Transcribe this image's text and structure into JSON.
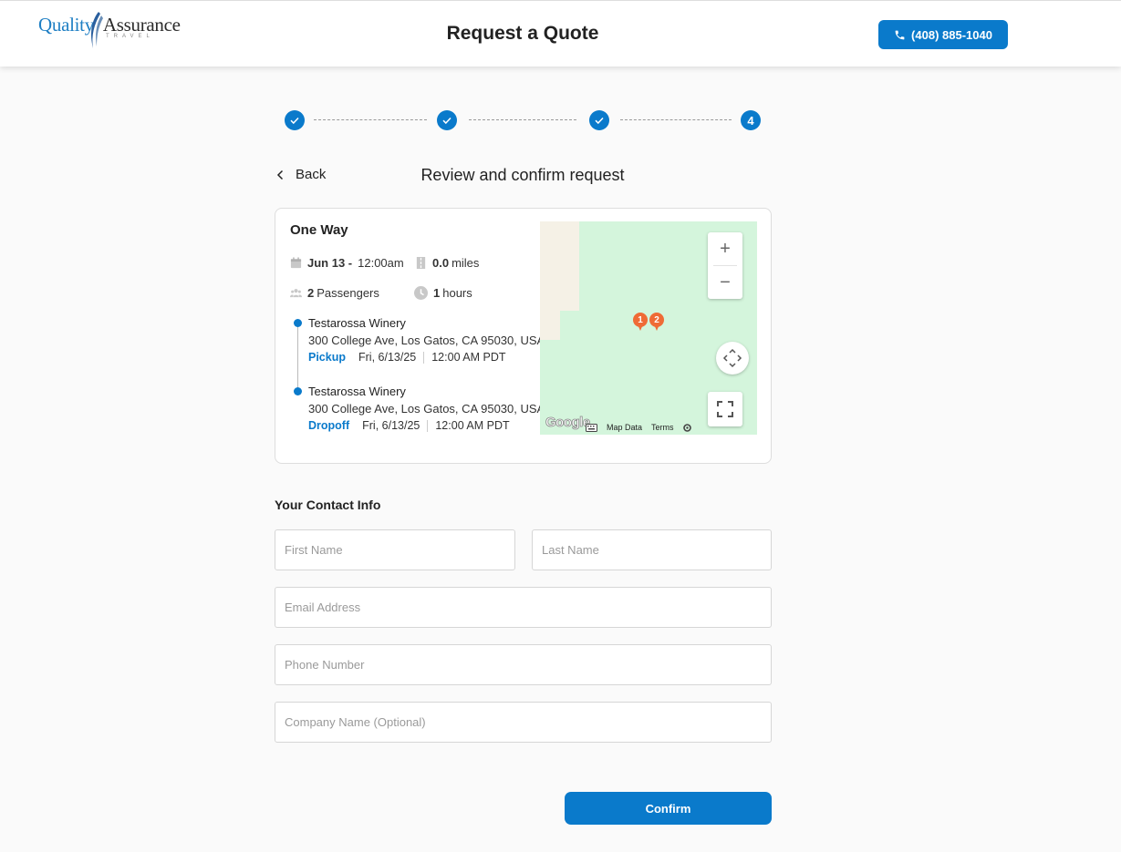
{
  "header": {
    "logo": {
      "word1": "Quality",
      "word2": "Assurance",
      "tagline": "TRAVEL"
    },
    "title": "Request a Quote",
    "phone_label": "(408) 885-1040"
  },
  "stepper": {
    "steps": [
      {
        "state": "complete"
      },
      {
        "state": "complete"
      },
      {
        "state": "complete"
      },
      {
        "state": "current",
        "label": "4"
      }
    ]
  },
  "nav": {
    "back_label": "Back",
    "subtitle": "Review and confirm request"
  },
  "trip": {
    "type": "One Way",
    "date": "Jun 13 -",
    "time": "12:00am",
    "distance_value": "0.0",
    "distance_unit": "miles",
    "passengers_value": "2",
    "passengers_unit": "Passengers",
    "duration_value": "1",
    "duration_unit": "hours",
    "stops": [
      {
        "name": "Testarossa Winery",
        "address": "300 College Ave, Los Gatos, CA 95030, USA",
        "kind": "Pickup",
        "date": "Fri, 6/13/25",
        "time": "12:00 AM PDT"
      },
      {
        "name": "Testarossa Winery",
        "address": "300 College Ave, Los Gatos, CA 95030, USA",
        "kind": "Dropoff",
        "date": "Fri, 6/13/25",
        "time": "12:00 AM PDT"
      }
    ]
  },
  "map": {
    "zoom_in": "+",
    "zoom_out": "−",
    "pins": [
      "1",
      "2"
    ],
    "google_label": "Google",
    "map_data_label": "Map Data",
    "terms_label": "Terms"
  },
  "contact": {
    "title": "Your Contact Info",
    "first_name_placeholder": "First Name",
    "last_name_placeholder": "Last Name",
    "email_placeholder": "Email Address",
    "phone_placeholder": "Phone Number",
    "company_placeholder": "Company Name (Optional)"
  },
  "confirm_label": "Confirm",
  "colors": {
    "accent": "#0a7acb",
    "pin": "#ef6b36",
    "map_green": "#d4f5dc"
  }
}
